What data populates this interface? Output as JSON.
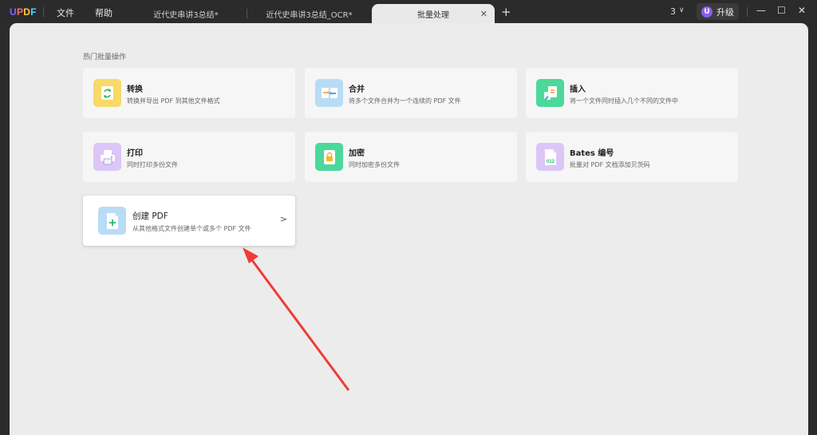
{
  "app": {
    "logo": "UPDF"
  },
  "menu": {
    "file": "文件",
    "help": "帮助"
  },
  "tabs": [
    {
      "label": "近代史串讲3总结*",
      "active": false
    },
    {
      "label": "近代史串讲3总结_OCR*",
      "active": false
    },
    {
      "label": "批量处理",
      "active": true
    }
  ],
  "titlebar": {
    "add_tab": "+",
    "page_count": "3",
    "chevron": "∨",
    "upgrade_avatar": "U",
    "upgrade_label": "升级",
    "minimize": "—",
    "maximize": "☐",
    "close": "✕",
    "tab_close": "✕"
  },
  "section": {
    "title": "热门批量操作"
  },
  "cards": [
    {
      "title": "转换",
      "desc": "转换并导出 PDF 到其他文件格式",
      "icon": "convert-icon",
      "color": "#f8d96a"
    },
    {
      "title": "合并",
      "desc": "将多个文件合并为一个连续的 PDF 文件",
      "icon": "merge-icon",
      "color": "#b9dcf5"
    },
    {
      "title": "插入",
      "desc": "将一个文件同时插入几个不同的文件中",
      "icon": "insert-icon",
      "color": "#4cd89a"
    },
    {
      "title": "打印",
      "desc": "同时打印多份文件",
      "icon": "print-icon",
      "color": "#dcc6f7"
    },
    {
      "title": "加密",
      "desc": "同时加密多份文件",
      "icon": "lock-icon",
      "color": "#4cd89a"
    },
    {
      "title": "Bates 编号",
      "desc": "批量对 PDF 文档添加贝茨码",
      "icon": "bates-number-icon",
      "color": "#dcc6f7"
    },
    {
      "title": "创建 PDF",
      "desc": "从其他格式文件创建单个或多个 PDF 文件",
      "icon": "create-pdf-icon",
      "color": "#b9dcf5",
      "arrow": ">"
    }
  ],
  "bates_icon_text": "012",
  "colors": {
    "annotation_arrow": "#ee3b36",
    "accent": "#8b5cf6"
  }
}
